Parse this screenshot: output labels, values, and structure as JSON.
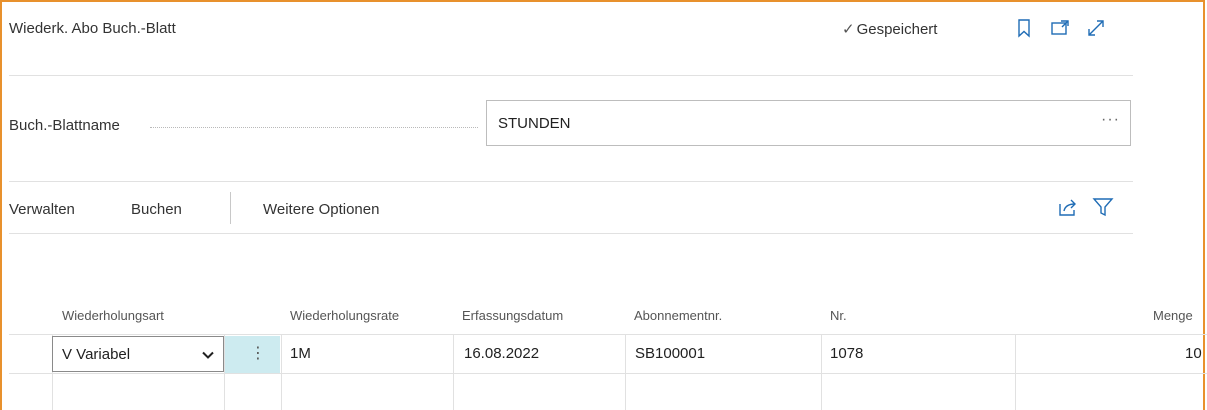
{
  "header": {
    "title": "Wiederk. Abo Buch.-Blatt",
    "saved_label": "Gespeichert",
    "icons": [
      "bookmark-icon",
      "open-in-new-window-icon",
      "expand-icon"
    ]
  },
  "journal_field": {
    "label": "Buch.-Blattname",
    "value": "STUNDEN",
    "more": "···"
  },
  "actions": {
    "manage": "Verwalten",
    "post": "Buchen",
    "more_options": "Weitere Optionen",
    "icons": [
      "share-icon",
      "filter-icon"
    ]
  },
  "table": {
    "columns": [
      "Wiederholungsart",
      "Wiederholungsrate",
      "Erfassungsdatum",
      "Abonnementnr.",
      "Nr.",
      "Menge"
    ],
    "rows": [
      {
        "recurring_method": "V Variabel",
        "menu": "⋮",
        "recurring_frequency": "1M",
        "posting_date": "16.08.2022",
        "subscription_no": "SB100001",
        "no": "1078",
        "quantity": "10"
      }
    ]
  },
  "colors": {
    "frame_accent": "#e8912d",
    "icon_blue": "#1f6cb5",
    "row_menu_bg": "#cdebf0"
  }
}
